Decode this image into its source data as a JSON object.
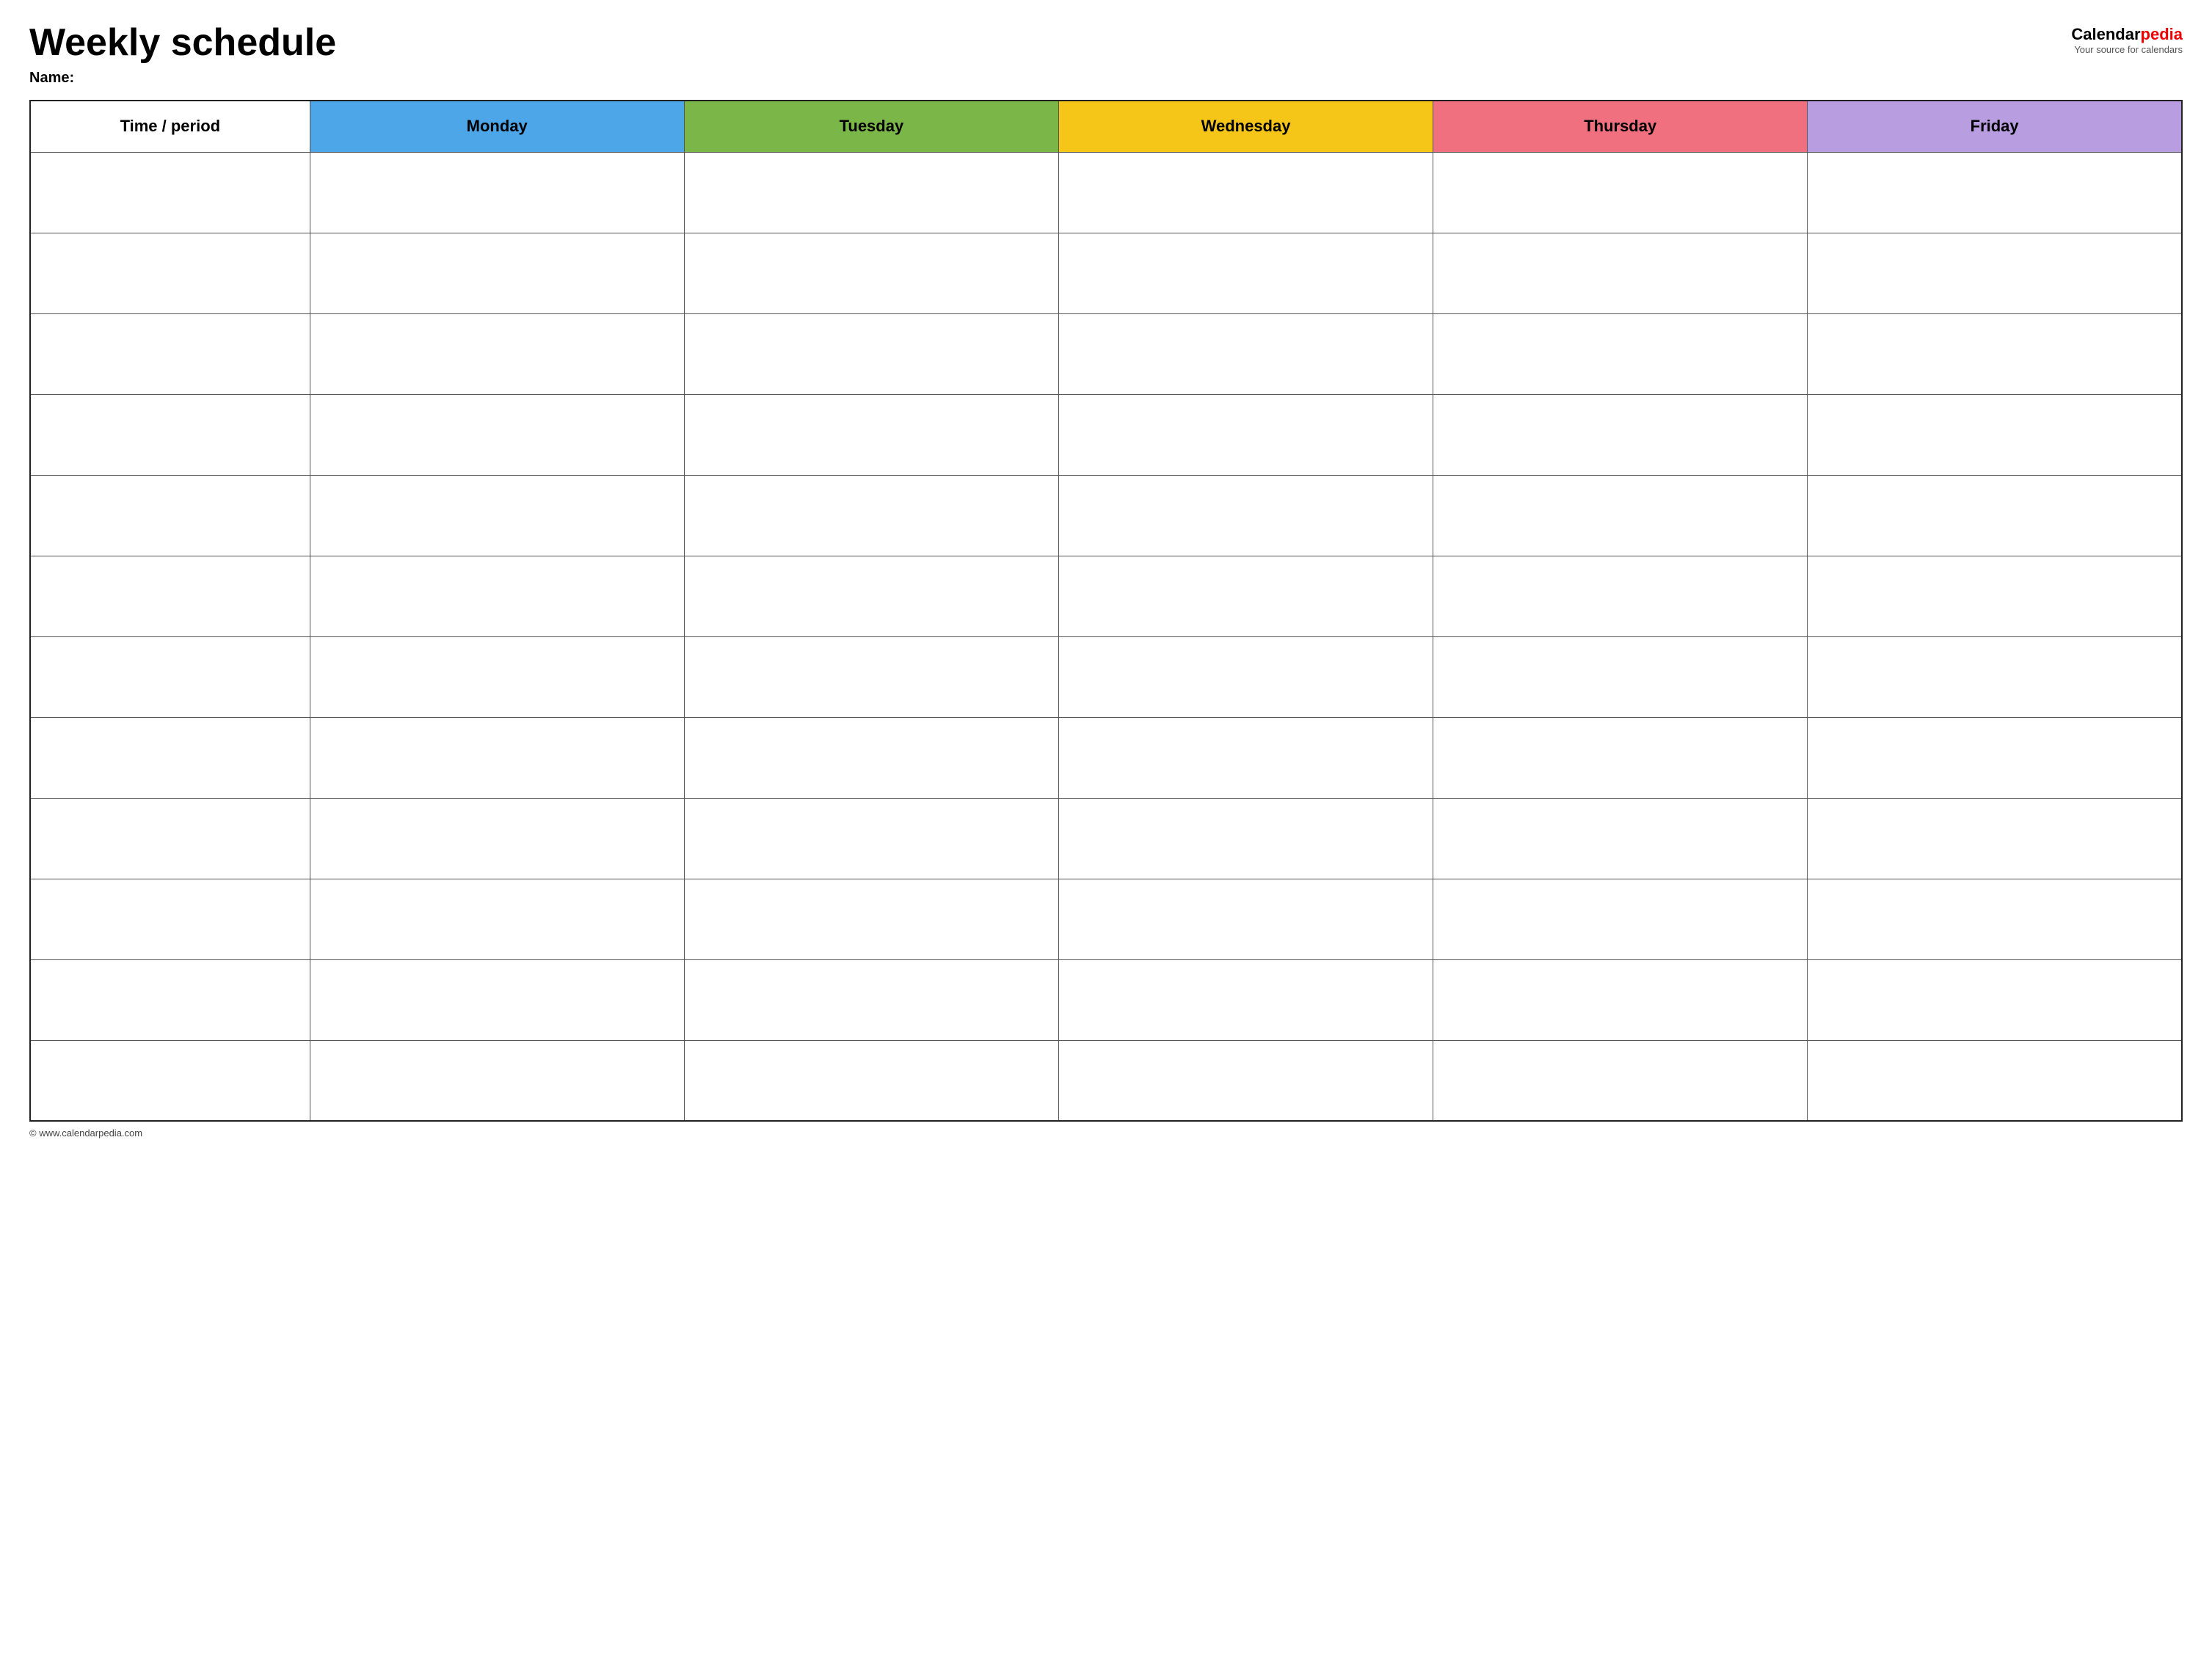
{
  "header": {
    "main_title": "Weekly schedule",
    "name_label": "Name:",
    "logo": {
      "calendar_text": "Calendar",
      "pedia_text": "pedia",
      "tagline": "Your source for calendars"
    }
  },
  "table": {
    "columns": [
      {
        "key": "time",
        "label": "Time / period",
        "color": "#fff",
        "class": "th-time"
      },
      {
        "key": "monday",
        "label": "Monday",
        "color": "#4da6e8",
        "class": "th-monday"
      },
      {
        "key": "tuesday",
        "label": "Tuesday",
        "color": "#7ab648",
        "class": "th-tuesday"
      },
      {
        "key": "wednesday",
        "label": "Wednesday",
        "color": "#f5c518",
        "class": "th-wednesday"
      },
      {
        "key": "thursday",
        "label": "Thursday",
        "color": "#f07080",
        "class": "th-thursday"
      },
      {
        "key": "friday",
        "label": "Friday",
        "color": "#b89de0",
        "class": "th-friday"
      }
    ],
    "row_count": 12
  },
  "footer": {
    "copyright": "© www.calendarpedia.com"
  }
}
